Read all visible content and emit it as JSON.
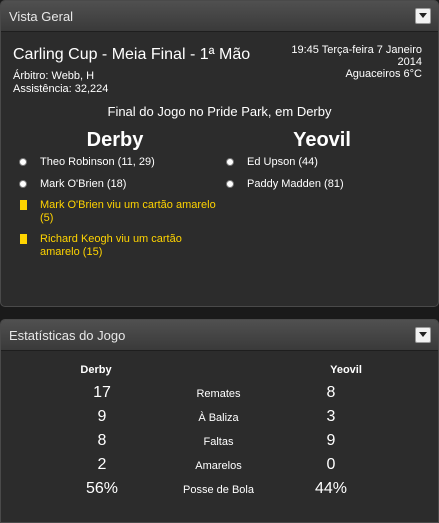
{
  "overview": {
    "title": "Vista Geral",
    "competition": "Carling Cup - Meia Final - 1ª Mão",
    "referee": "Árbitro: Webb, H",
    "attendance": "Assistência: 32,224",
    "kickoff_line1": "19:45 Terça-feira 7 Janeiro",
    "kickoff_line2": "2014",
    "weather": "Aguaceiros 6°C",
    "final_line": "Final do Jogo no Pride Park, em Derby",
    "home_team": "Derby",
    "away_team": "Yeovil",
    "home_events": [
      {
        "type": "goal",
        "icon": "ball-icon",
        "text": "Theo Robinson (11, 29)"
      },
      {
        "type": "goal",
        "icon": "ball-icon",
        "text": "Mark O'Brien (18)"
      },
      {
        "type": "card",
        "icon": "yellow-card-icon",
        "text": "Mark O'Brien viu um cartão amarelo (5)"
      },
      {
        "type": "card",
        "icon": "yellow-card-icon",
        "text": "Richard Keogh viu um cartão amarelo (15)"
      }
    ],
    "away_events": [
      {
        "type": "goal",
        "icon": "ball-icon",
        "text": "Ed Upson (44)"
      },
      {
        "type": "goal",
        "icon": "ball-icon",
        "text": "Paddy Madden (81)"
      }
    ]
  },
  "stats": {
    "title": "Estatísticas do Jogo",
    "home_team": "Derby",
    "away_team": "Yeovil",
    "rows": [
      {
        "label": "Remates",
        "home": "17",
        "away": "8"
      },
      {
        "label": "À Baliza",
        "home": "9",
        "away": "3"
      },
      {
        "label": "Faltas",
        "home": "8",
        "away": "9"
      },
      {
        "label": "Amarelos",
        "home": "2",
        "away": "0"
      },
      {
        "label": "Posse de Bola",
        "home": "56%",
        "away": "44%"
      }
    ]
  },
  "colors": {
    "card_text": "#ffd400",
    "panel_bg": "#2c2c2c",
    "header_bg": "#454545"
  }
}
